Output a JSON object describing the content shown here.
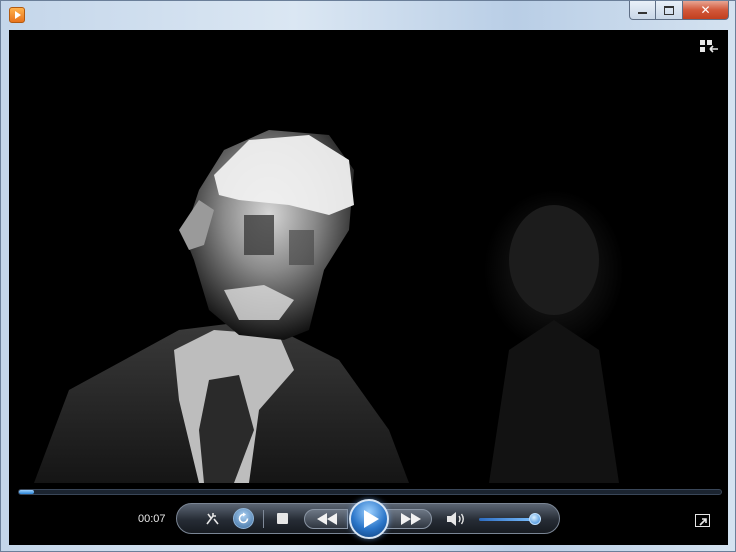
{
  "window": {
    "title": "",
    "controls": {
      "minimize": "minimize",
      "maximize": "maximize",
      "close": "close"
    }
  },
  "player": {
    "elapsed_time": "00:07",
    "seek_progress": 0.022,
    "volume_level": 0.9,
    "repeat_active": true,
    "shuffle_active": false,
    "is_playing": false
  },
  "icons": {
    "app": "media-player-icon",
    "switch_library": "switch-to-library-icon",
    "shuffle": "shuffle-icon",
    "repeat": "repeat-icon",
    "stop": "stop-icon",
    "previous": "previous-icon",
    "play": "play-icon",
    "next": "next-icon",
    "volume": "speaker-icon",
    "fullscreen": "fullscreen-icon"
  },
  "colors": {
    "accent": "#2b76c9",
    "video_bg": "#000000",
    "control_bar": "#000000"
  }
}
